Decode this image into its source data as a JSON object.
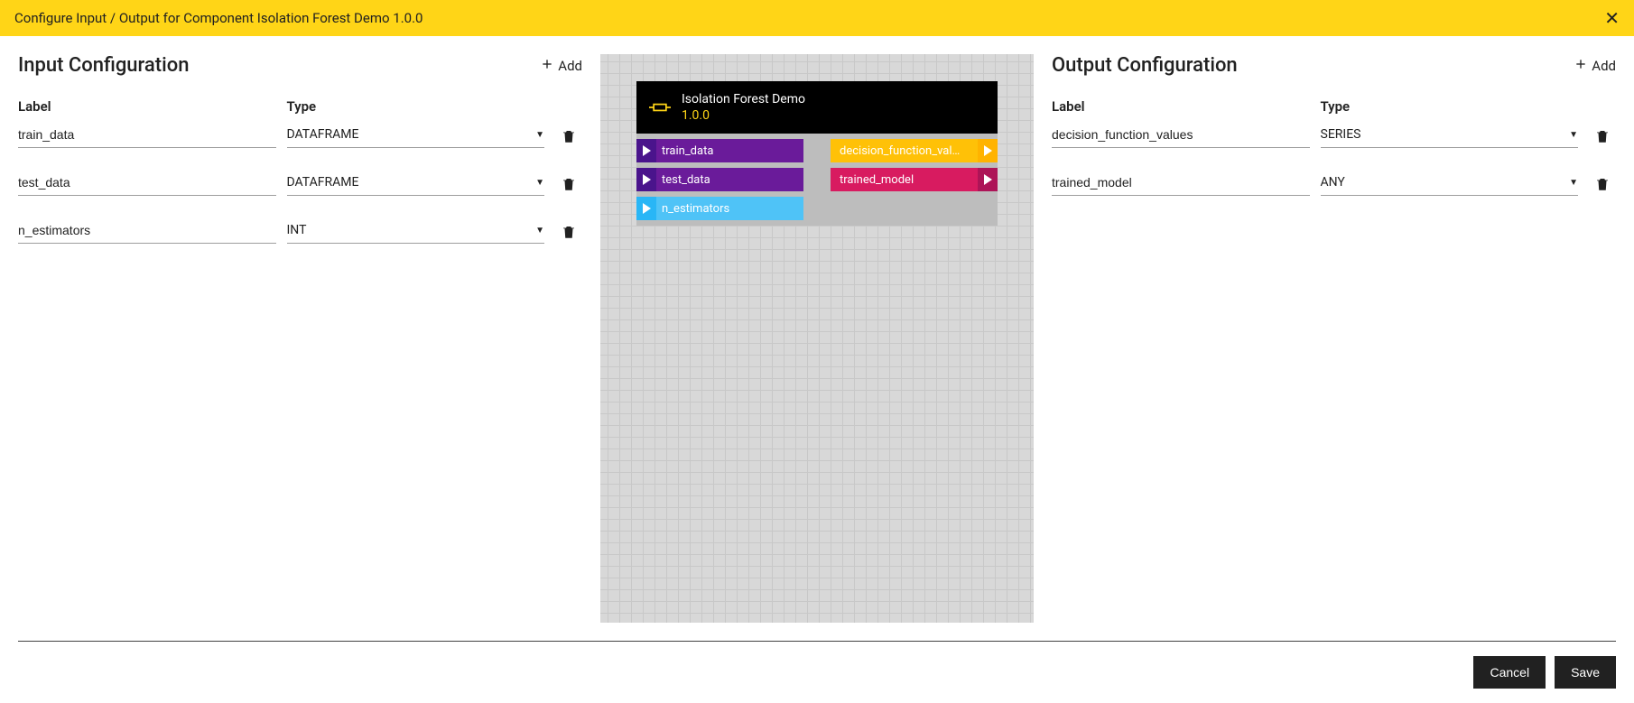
{
  "header": {
    "title": "Configure Input / Output for Component Isolation Forest Demo 1.0.0"
  },
  "input_panel": {
    "title": "Input Configuration",
    "add_label": "Add",
    "label_header": "Label",
    "type_header": "Type",
    "rows": [
      {
        "label": "train_data",
        "type": "DATAFRAME"
      },
      {
        "label": "test_data",
        "type": "DATAFRAME"
      },
      {
        "label": "n_estimators",
        "type": "INT"
      }
    ]
  },
  "output_panel": {
    "title": "Output Configuration",
    "add_label": "Add",
    "label_header": "Label",
    "type_header": "Type",
    "rows": [
      {
        "label": "decision_function_values",
        "type": "SERIES"
      },
      {
        "label": "trained_model",
        "type": "ANY"
      }
    ]
  },
  "canvas": {
    "component_name": "Isolation Forest Demo",
    "component_version": "1.0.0",
    "inputs": [
      {
        "label": "train_data",
        "color": "purple"
      },
      {
        "label": "test_data",
        "color": "purple"
      },
      {
        "label": "n_estimators",
        "color": "blue"
      }
    ],
    "outputs": [
      {
        "label": "decision_function_val…",
        "color": "yellow"
      },
      {
        "label": "trained_model",
        "color": "magenta"
      }
    ]
  },
  "footer": {
    "cancel": "Cancel",
    "save": "Save"
  }
}
